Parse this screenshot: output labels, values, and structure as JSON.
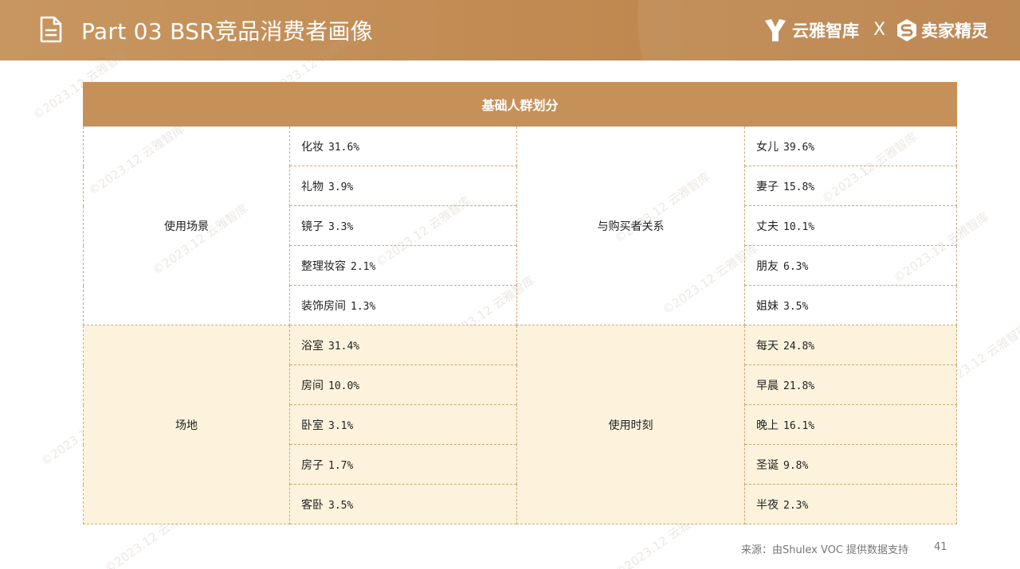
{
  "header": {
    "title": "Part 03  BSR竞品消费者画像",
    "brand_left": "云雅智库",
    "separator": "X",
    "brand_right": "卖家精灵"
  },
  "table": {
    "title": "基础人群划分",
    "groups": [
      {
        "left": {
          "category": "使用场景",
          "items": [
            {
              "label": "化妆",
              "value": "31.6%"
            },
            {
              "label": "礼物",
              "value": "3.9%"
            },
            {
              "label": "镜子",
              "value": "3.3%"
            },
            {
              "label": "整理妆容",
              "value": "2.1%"
            },
            {
              "label": "装饰房间",
              "value": "1.3%"
            }
          ]
        },
        "right": {
          "category": "与购买者关系",
          "items": [
            {
              "label": "女儿",
              "value": "39.6%"
            },
            {
              "label": "妻子",
              "value": "15.8%"
            },
            {
              "label": "丈夫",
              "value": "10.1%"
            },
            {
              "label": "朋友",
              "value": "6.3%"
            },
            {
              "label": "姐妹",
              "value": "3.5%"
            }
          ]
        }
      },
      {
        "left": {
          "category": "场地",
          "items": [
            {
              "label": "浴室",
              "value": "31.4%"
            },
            {
              "label": "房间",
              "value": "10.0%"
            },
            {
              "label": "卧室",
              "value": "3.1%"
            },
            {
              "label": "房子",
              "value": "1.7%"
            },
            {
              "label": "客卧",
              "value": "3.5%"
            }
          ]
        },
        "right": {
          "category": "使用时刻",
          "items": [
            {
              "label": "每天",
              "value": "24.8%"
            },
            {
              "label": "早晨",
              "value": "21.8%"
            },
            {
              "label": "晚上",
              "value": "16.1%"
            },
            {
              "label": "圣诞",
              "value": "9.8%"
            },
            {
              "label": "半夜",
              "value": "2.3%"
            }
          ]
        }
      }
    ]
  },
  "watermark": "©2023.12  云雅智库",
  "footer": {
    "source": "来源：由Shulex VOC 提供数据支持",
    "page_number": "41"
  },
  "colors": {
    "header_bg": "#c08a52",
    "table_header_bg": "#c69159",
    "group2_bg": "#fdf3dc",
    "border": "#c9a87a"
  },
  "icons": [
    "document-icon",
    "yunya-logo-icon",
    "maijia-logo-icon"
  ]
}
